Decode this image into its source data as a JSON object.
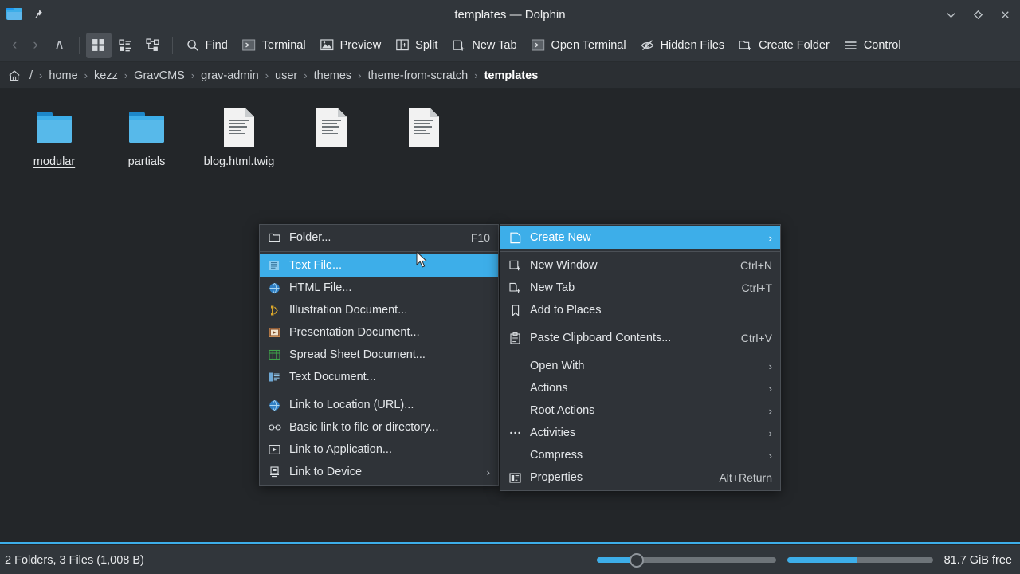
{
  "window": {
    "title": "templates — Dolphin",
    "app_icon": "folder-icon",
    "pin_icon": "pin-icon",
    "controls": [
      {
        "name": "minimize-button",
        "icon": "chevron-down-icon"
      },
      {
        "name": "maximize-button",
        "icon": "diamond-icon"
      },
      {
        "name": "close-button",
        "icon": "close-icon"
      }
    ]
  },
  "toolbar": {
    "back_label": "‹",
    "forward_label": "›",
    "up_label": "∧",
    "view_modes": [
      {
        "name": "icons-view",
        "icon": "grid-icon",
        "active": true
      },
      {
        "name": "compact-view",
        "icon": "list-icon",
        "active": false
      },
      {
        "name": "details-view",
        "icon": "tree-icon",
        "active": false
      }
    ],
    "buttons": [
      {
        "label": "Find",
        "icon": "search-icon"
      },
      {
        "label": "Terminal",
        "icon": "terminal-icon"
      },
      {
        "label": "Preview",
        "icon": "image-icon"
      },
      {
        "label": "Split",
        "icon": "split-icon"
      },
      {
        "label": "New Tab",
        "icon": "new-tab-icon"
      },
      {
        "label": "Open Terminal",
        "icon": "terminal-icon"
      },
      {
        "label": "Hidden Files",
        "icon": "hidden-eye-icon"
      },
      {
        "label": "Create Folder",
        "icon": "new-folder-icon"
      },
      {
        "label": "Control",
        "icon": "hamburger-icon"
      }
    ]
  },
  "breadcrumb": {
    "home_icon": "home-icon",
    "root": "/",
    "separator": "›",
    "items": [
      "home",
      "kezz",
      "GravCMS",
      "grav-admin",
      "user",
      "themes",
      "theme-from-scratch"
    ],
    "current": "templates"
  },
  "files": [
    {
      "name": "modular",
      "type": "folder",
      "hovered": true
    },
    {
      "name": "partials",
      "type": "folder",
      "hovered": false
    },
    {
      "name": "blog.html.twig",
      "type": "file",
      "hovered": false
    },
    {
      "name": "",
      "type": "file",
      "hovered": false
    },
    {
      "name": "",
      "type": "file",
      "hovered": false
    }
  ],
  "create_new_menu": {
    "items": [
      {
        "label": "Folder...",
        "icon": "folder-outline-icon",
        "shortcut": "F10",
        "highlight": false,
        "submenu": false
      },
      {
        "separator": true
      },
      {
        "label": "Text File...",
        "icon": "text-file-icon",
        "shortcut": "",
        "highlight": true,
        "submenu": false
      },
      {
        "label": "HTML File...",
        "icon": "globe-icon",
        "shortcut": "",
        "highlight": false,
        "submenu": false
      },
      {
        "label": "Illustration Document...",
        "icon": "illustration-icon",
        "shortcut": "",
        "highlight": false,
        "submenu": false
      },
      {
        "label": "Presentation Document...",
        "icon": "presentation-icon",
        "shortcut": "",
        "highlight": false,
        "submenu": false
      },
      {
        "label": "Spread Sheet Document...",
        "icon": "spreadsheet-icon",
        "shortcut": "",
        "highlight": false,
        "submenu": false
      },
      {
        "label": "Text Document...",
        "icon": "text-document-icon",
        "shortcut": "",
        "highlight": false,
        "submenu": false
      },
      {
        "separator": true
      },
      {
        "label": "Link to Location (URL)...",
        "icon": "globe-icon",
        "shortcut": "",
        "highlight": false,
        "submenu": false
      },
      {
        "label": "Basic link to file or directory...",
        "icon": "link-icon",
        "shortcut": "",
        "highlight": false,
        "submenu": false
      },
      {
        "label": "Link to Application...",
        "icon": "application-icon",
        "shortcut": "",
        "highlight": false,
        "submenu": false
      },
      {
        "label": "Link to Device",
        "icon": "device-icon",
        "shortcut": "",
        "highlight": false,
        "submenu": true
      }
    ]
  },
  "context_menu": {
    "items": [
      {
        "label": "Create New",
        "icon": "new-file-icon",
        "shortcut": "",
        "highlight": true,
        "submenu": true
      },
      {
        "separator": true
      },
      {
        "label": "New Window",
        "icon": "new-window-icon",
        "shortcut": "Ctrl+N",
        "highlight": false,
        "submenu": false
      },
      {
        "label": "New Tab",
        "icon": "new-tab-icon",
        "shortcut": "Ctrl+T",
        "highlight": false,
        "submenu": false
      },
      {
        "label": "Add to Places",
        "icon": "bookmark-icon",
        "shortcut": "",
        "highlight": false,
        "submenu": false
      },
      {
        "separator": true
      },
      {
        "label": "Paste Clipboard Contents...",
        "icon": "clipboard-icon",
        "shortcut": "Ctrl+V",
        "highlight": false,
        "submenu": false
      },
      {
        "separator": true
      },
      {
        "label": "Open With",
        "icon": "",
        "shortcut": "",
        "highlight": false,
        "submenu": true
      },
      {
        "label": "Actions",
        "icon": "",
        "shortcut": "",
        "highlight": false,
        "submenu": true
      },
      {
        "label": "Root Actions",
        "icon": "",
        "shortcut": "",
        "highlight": false,
        "submenu": true
      },
      {
        "label": "Activities",
        "icon": "dots-icon",
        "shortcut": "",
        "highlight": false,
        "submenu": true
      },
      {
        "label": "Compress",
        "icon": "",
        "shortcut": "",
        "highlight": false,
        "submenu": true
      },
      {
        "label": "Properties",
        "icon": "properties-icon",
        "shortcut": "Alt+Return",
        "highlight": false,
        "submenu": false
      }
    ]
  },
  "statusbar": {
    "summary": "2 Folders, 3 Files (1,008 B)",
    "free_space": "81.7 GiB free",
    "zoom_value": 18,
    "space_used_percent": 48
  },
  "colors": {
    "accent": "#3daee9",
    "window_bg": "#31363b",
    "view_bg": "#232629",
    "menu_bg": "#2f3338",
    "text": "#eff0f1"
  }
}
